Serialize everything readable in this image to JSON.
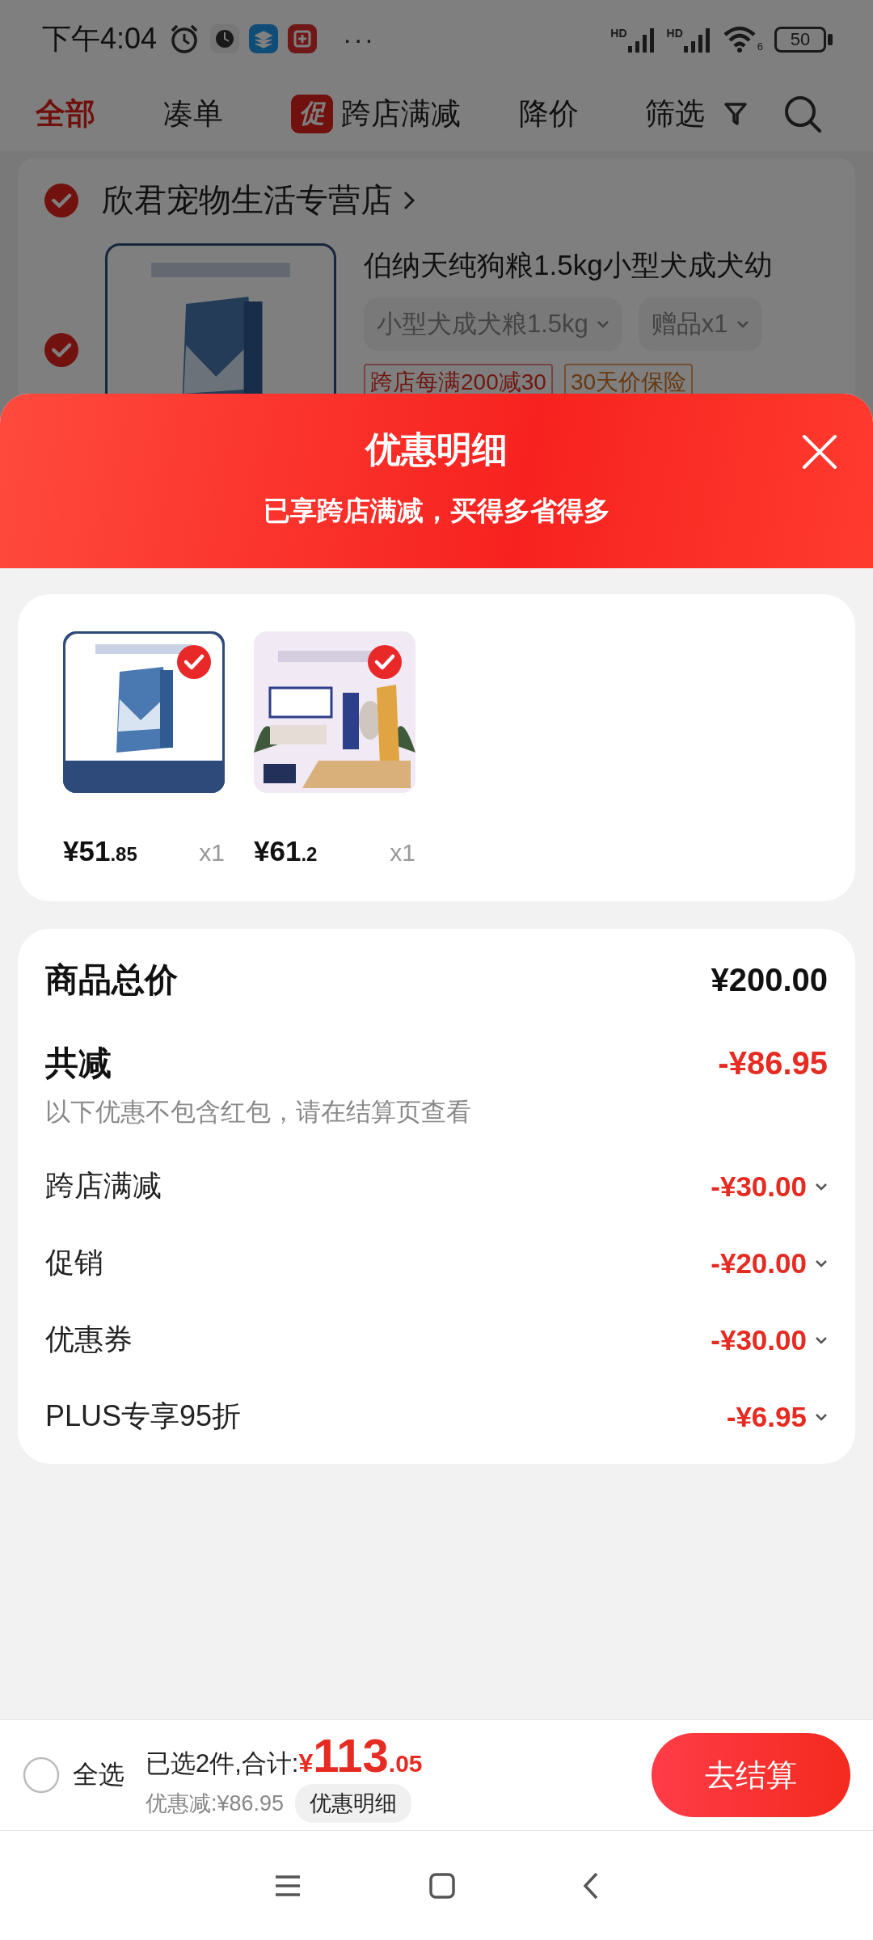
{
  "status_bar": {
    "time": "下午4:04",
    "more": "···",
    "signal_labels": [
      "HD",
      "HD"
    ],
    "wifi_label": "6",
    "battery": "50"
  },
  "tabs": [
    {
      "label": "全部",
      "selected": true,
      "kind": "plain"
    },
    {
      "label": "凑单",
      "selected": false,
      "kind": "plain"
    },
    {
      "label": "跨店满减",
      "badge": "促",
      "selected": false,
      "kind": "badge"
    },
    {
      "label": "降价",
      "selected": false,
      "kind": "plain"
    },
    {
      "label": "筛选",
      "selected": false,
      "kind": "filter"
    }
  ],
  "store": {
    "name": "欣君宠物生活专营店",
    "checked": true,
    "item": {
      "checked": true,
      "kind": "picture",
      "title": "伯纳天纯狗粮1.5kg小型犬成犬幼",
      "spec": "小型犬成犬粮1.5kg",
      "gift": "赠品x1",
      "tags": [
        "跨店每满200减30",
        "30天价保险"
      ]
    }
  },
  "sheet": {
    "title": "优惠明细",
    "subtitle": "已享跨店满减，买得多省得多",
    "products": [
      {
        "kind": "picture",
        "selected": true,
        "price": "¥51",
        "decimal": ".85",
        "qty": "x1"
      },
      {
        "kind": "picture",
        "selected": true,
        "price": "¥61",
        "decimal": ".2",
        "qty": "x1"
      }
    ],
    "total": {
      "label": "商品总价",
      "value": "¥200.00"
    },
    "reduction": {
      "label": "共减",
      "value": "-¥86.95",
      "note": "以下优惠不包含红包，请在结算页查看"
    },
    "discounts": [
      {
        "label": "跨店满减",
        "value": "-¥30.00",
        "expanded": false
      },
      {
        "label": "促销",
        "value": "-¥20.00",
        "expanded": false
      },
      {
        "label": "优惠券",
        "value": "-¥30.00",
        "expanded": false
      },
      {
        "label": "PLUS专享95折",
        "value": "-¥6.95",
        "expanded": false
      }
    ]
  },
  "bottom_bar": {
    "select_all": {
      "label": "全选",
      "checked": false
    },
    "selected_text": "已选2件,合计:",
    "currency": "¥",
    "total_main": "113",
    "total_decimal": ".05",
    "saved": "优惠减:¥86.95",
    "detail_button": "优惠明细",
    "checkout_button": "去结算"
  }
}
